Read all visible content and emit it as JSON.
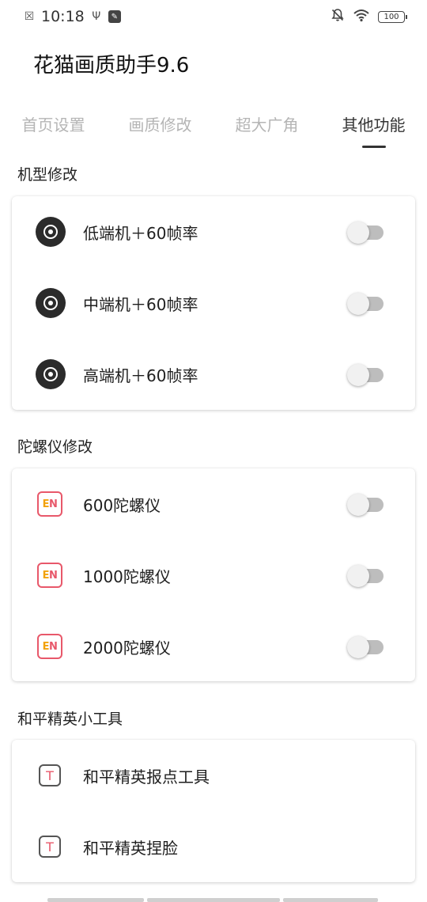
{
  "status_bar": {
    "time": "10:18",
    "icons_left": [
      "close-notification-icon",
      "usb-icon",
      "app-box-icon"
    ],
    "icons_right": [
      "bell-off-icon",
      "wifi-icon"
    ],
    "battery": "100"
  },
  "app": {
    "title": "花猫画质助手9.6"
  },
  "tabs": [
    {
      "label": "首页设置",
      "active": false
    },
    {
      "label": "画质修改",
      "active": false
    },
    {
      "label": "超大广角",
      "active": false
    },
    {
      "label": "其他功能",
      "active": true
    }
  ],
  "sections": [
    {
      "header": "机型修改",
      "items": [
        {
          "label": "低端机＋60帧率",
          "icon": "disc-icon",
          "toggle": false
        },
        {
          "label": "中端机＋60帧率",
          "icon": "disc-icon",
          "toggle": false
        },
        {
          "label": "高端机＋60帧率",
          "icon": "disc-icon",
          "toggle": false
        }
      ]
    },
    {
      "header": "陀螺仪修改",
      "items": [
        {
          "label": "600陀螺仪",
          "icon": "en-icon",
          "toggle": false
        },
        {
          "label": "1000陀螺仪",
          "icon": "en-icon",
          "toggle": false
        },
        {
          "label": "2000陀螺仪",
          "icon": "en-icon",
          "toggle": false
        }
      ]
    },
    {
      "header": "和平精英小工具",
      "items": [
        {
          "label": "和平精英报点工具",
          "icon": "t-icon"
        },
        {
          "label": "和平精英捏脸",
          "icon": "t-icon"
        }
      ]
    }
  ],
  "colors": {
    "accent_red": "#e8586a",
    "accent_orange": "#f2a20c",
    "tab_inactive": "#b5b5b5",
    "tab_active": "#333333"
  }
}
